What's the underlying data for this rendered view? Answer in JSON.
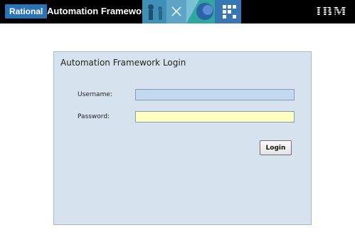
{
  "header": {
    "brand_badge": "Rational",
    "app_title": "Automation Framework",
    "logo_text": "IBM",
    "colors": {
      "bar": "#000000",
      "badge": "#2a74b5"
    }
  },
  "login": {
    "title": "Automation Framework Login",
    "username_label": "Username:",
    "username_value": "",
    "password_label": "Password:",
    "password_value": "",
    "login_button": "Login",
    "colors": {
      "panel": "#d6e2ee",
      "username_field": "#c5d9f1",
      "password_field": "#ffffc0"
    }
  }
}
